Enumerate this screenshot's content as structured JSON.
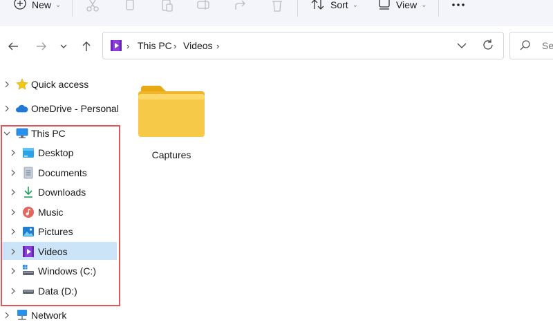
{
  "toolbar": {
    "new_label": "New",
    "sort_label": "Sort",
    "view_label": "View",
    "icons": [
      "plus-icon",
      "cut-icon",
      "copy-icon",
      "paste-icon",
      "rename-icon",
      "share-icon",
      "delete-icon",
      "sort-icon",
      "view-icon",
      "more-icon"
    ]
  },
  "address": {
    "segments": [
      "This PC",
      "Videos"
    ],
    "search_placeholder": "Sea"
  },
  "navigation": {
    "items": [
      {
        "label": "Quick access",
        "icon": "star-icon"
      },
      {
        "label": "OneDrive - Personal",
        "icon": "cloud-icon"
      },
      {
        "label": "This PC",
        "icon": "monitor-icon"
      },
      {
        "label": "Desktop",
        "icon": "desktop-icon"
      },
      {
        "label": "Documents",
        "icon": "documents-icon"
      },
      {
        "label": "Downloads",
        "icon": "downloads-icon"
      },
      {
        "label": "Music",
        "icon": "music-icon"
      },
      {
        "label": "Pictures",
        "icon": "pictures-icon"
      },
      {
        "label": "Videos",
        "icon": "videos-icon"
      },
      {
        "label": "Windows (C:)",
        "icon": "drive-c-icon"
      },
      {
        "label": "Data (D:)",
        "icon": "drive-d-icon"
      },
      {
        "label": "Network",
        "icon": "network-icon"
      }
    ],
    "selected": "Videos"
  },
  "content": {
    "items": [
      {
        "name": "Captures",
        "type": "folder"
      }
    ]
  },
  "colors": {
    "toolbar_bg": "#f3f5fa",
    "selected_bg": "#cce4f7",
    "highlight_border": "#e0565a",
    "folder_yellow": "#f7c948",
    "videos_purple": "#8b3fd9"
  }
}
